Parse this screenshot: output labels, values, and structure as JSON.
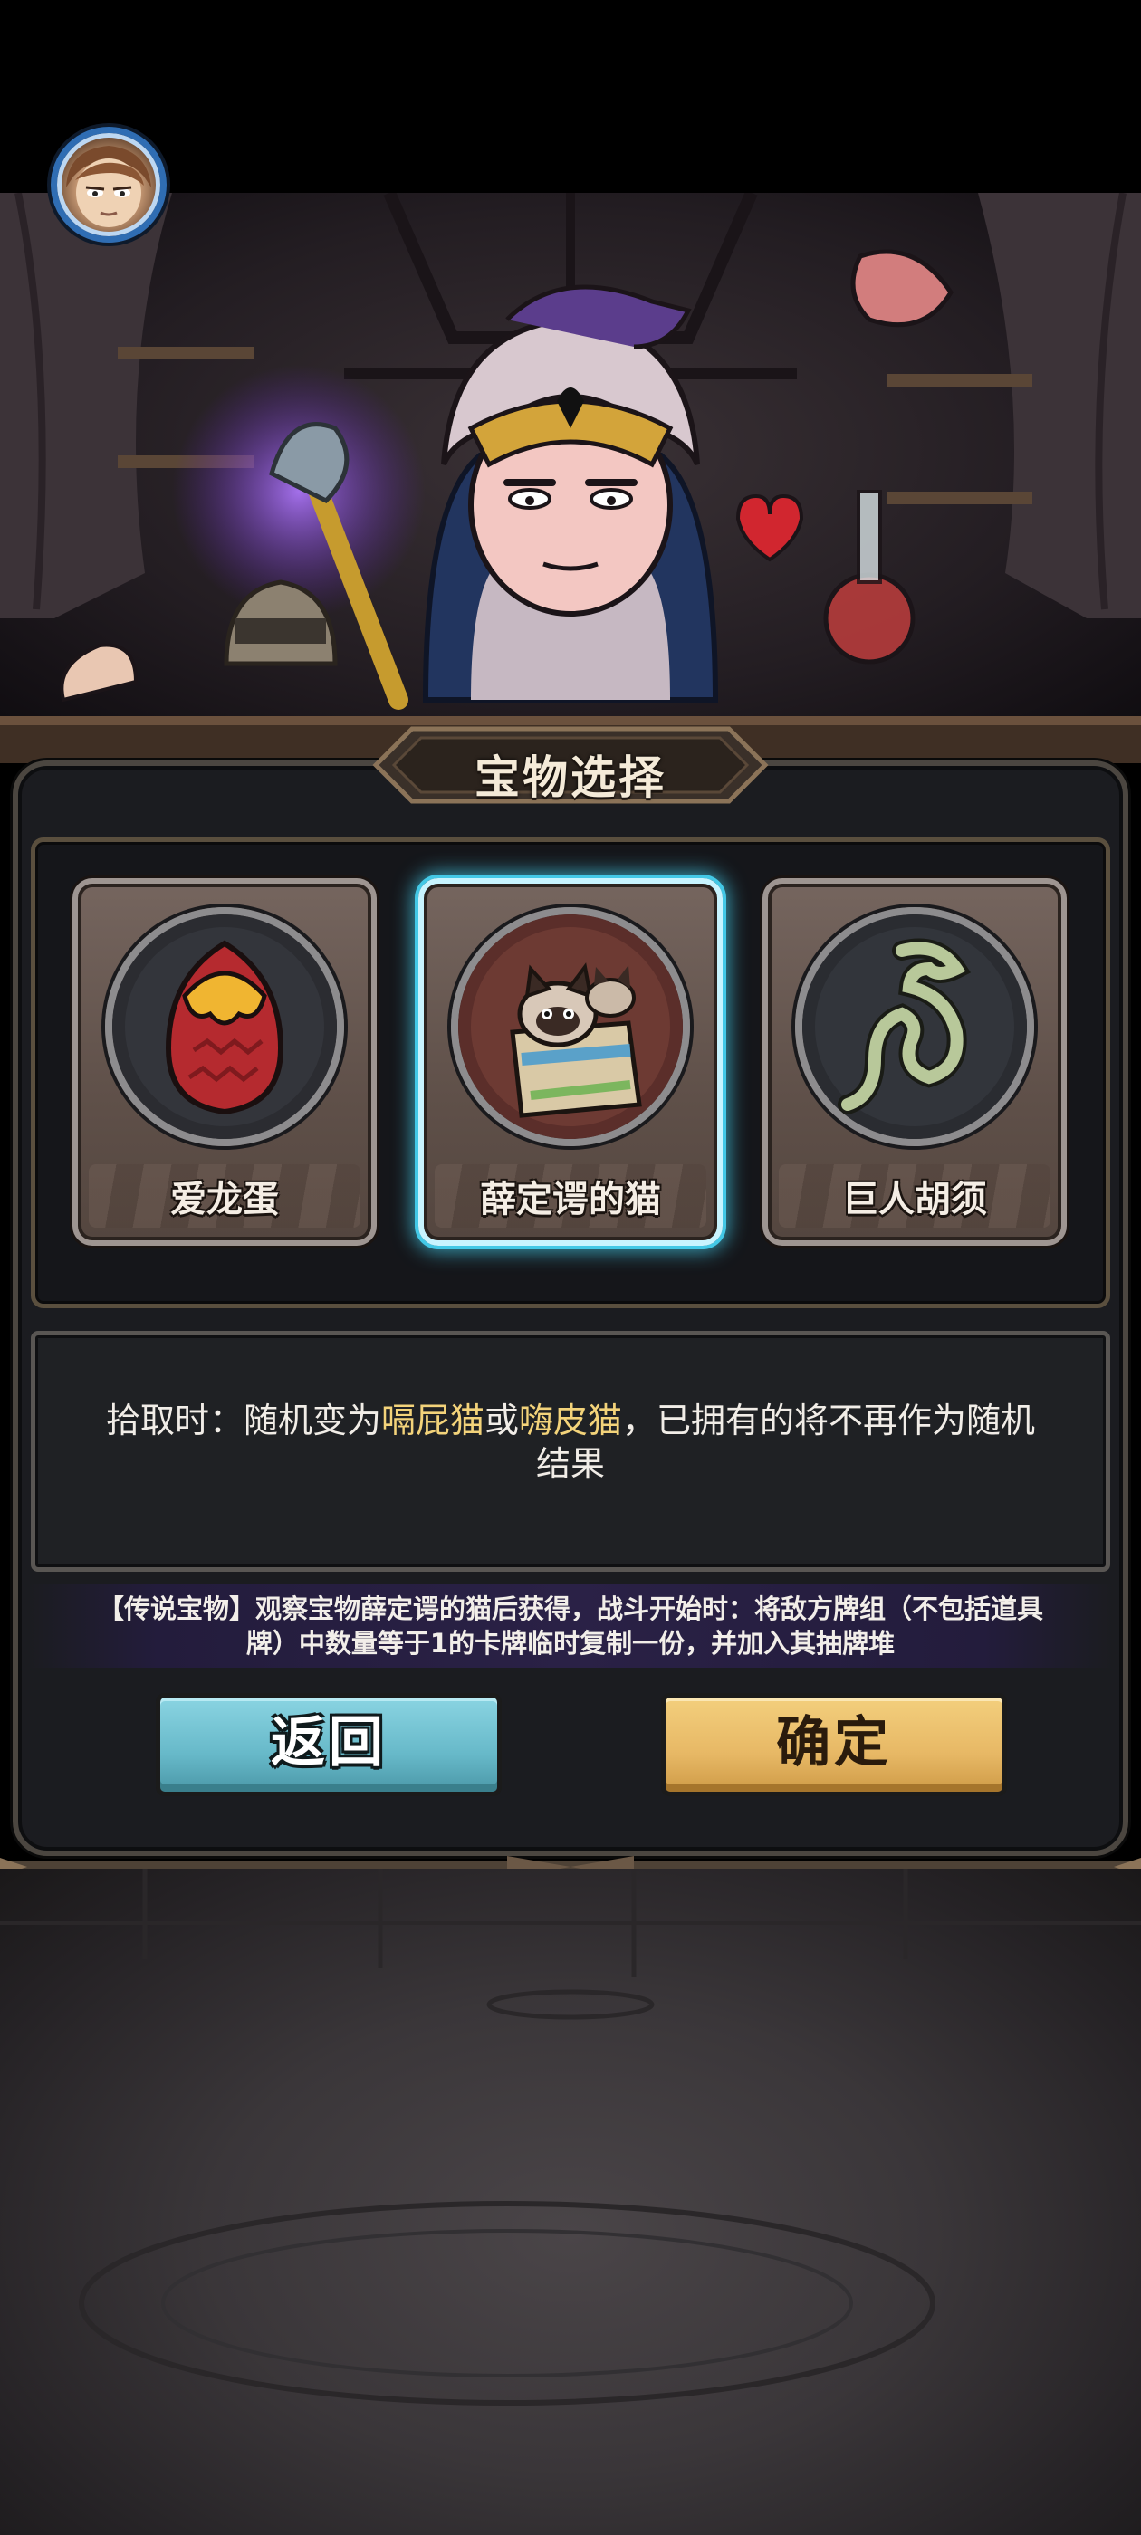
{
  "header": {
    "avatar_icon": "player-avatar-portrait"
  },
  "dialog": {
    "title": "宝物选择",
    "treasures": [
      {
        "label": "爱龙蛋",
        "icon": "dragon-egg-icon",
        "selected": false
      },
      {
        "label": "薛定谔的猫",
        "icon": "cat-in-box-icon",
        "selected": true
      },
      {
        "label": "巨人胡须",
        "icon": "giant-beard-icon",
        "selected": false
      }
    ],
    "description": {
      "prefix": "拾取时：随机变为",
      "highlight_1": "嗝屁猫",
      "middle": "或",
      "highlight_2": "嗨皮猫",
      "suffix": "，已拥有的将不再作为随机结果"
    },
    "legend_note": "【传说宝物】观察宝物薛定谔的猫后获得，战斗开始时：将敌方牌组（不包括道具牌）中数量等于1的卡牌临时复制一份，并加入其抽牌堆",
    "buttons": {
      "back_label": "返回",
      "confirm_label": "确定"
    }
  },
  "colors": {
    "highlight_text": "#f3d37a",
    "selected_glow": "#43c8e6",
    "back_button": "#67b9c9",
    "confirm_button": "#e7b865"
  }
}
